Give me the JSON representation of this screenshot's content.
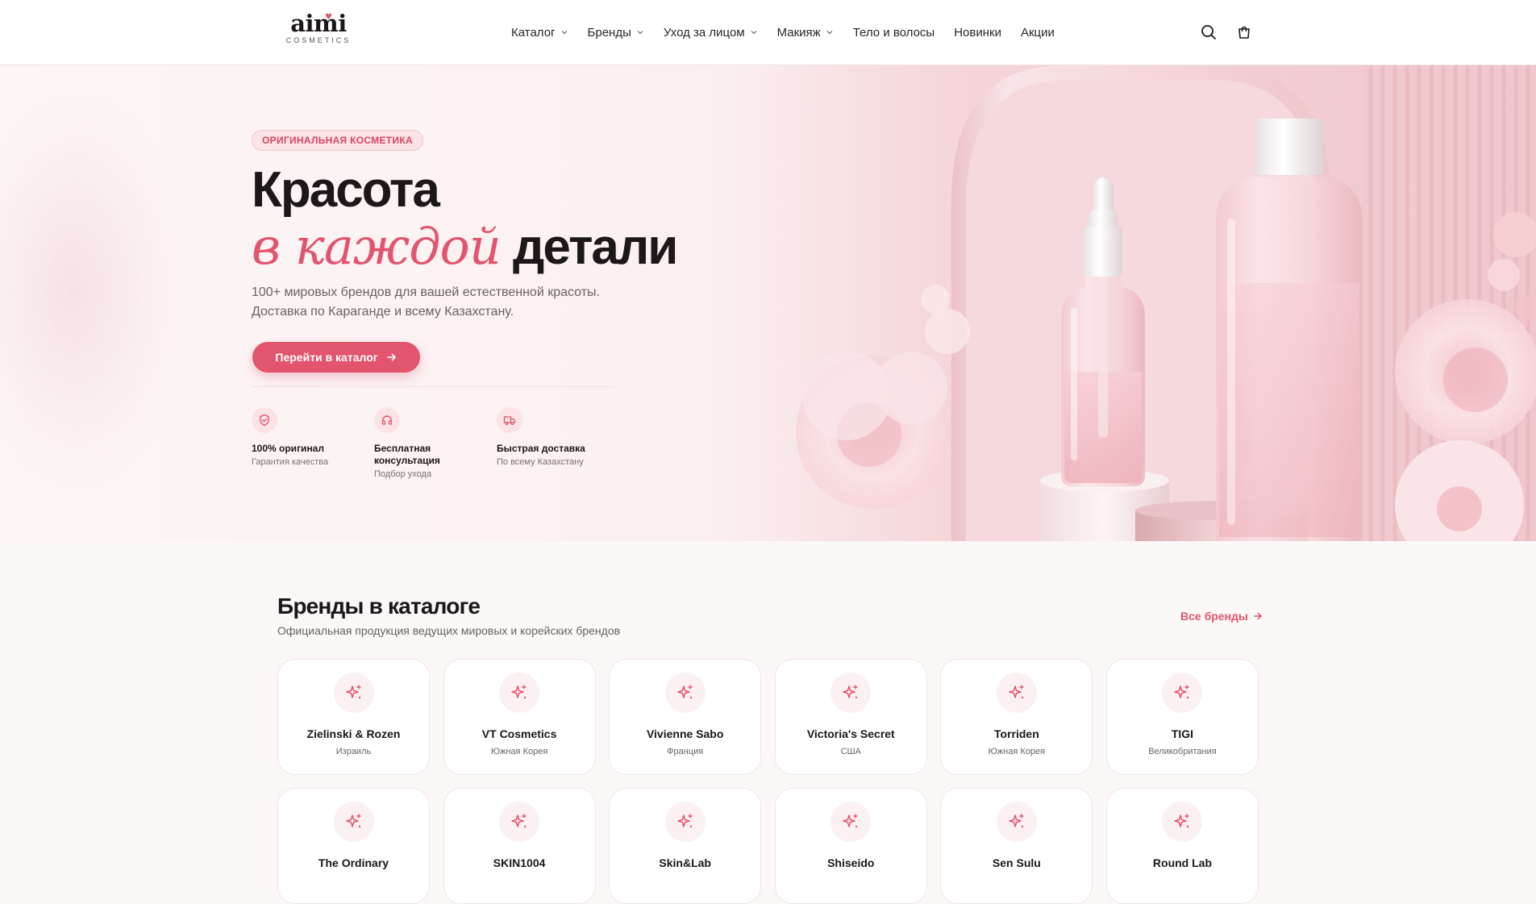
{
  "header": {
    "logo": {
      "main": "aimi",
      "sub": "COSMETICS"
    },
    "nav": [
      {
        "label": "Каталог",
        "dropdown": true
      },
      {
        "label": "Бренды",
        "dropdown": true
      },
      {
        "label": "Уход за лицом",
        "dropdown": true
      },
      {
        "label": "Макияж",
        "dropdown": true
      },
      {
        "label": "Тело и волосы",
        "dropdown": false
      },
      {
        "label": "Новинки",
        "dropdown": false
      },
      {
        "label": "Акции",
        "dropdown": false
      }
    ],
    "icons": [
      "search-icon",
      "cart-icon"
    ]
  },
  "hero": {
    "badge": "ОРИГИНАЛЬНАЯ КОСМЕТИКА",
    "title_line1": "Красота",
    "title_accent": "в каждой",
    "title_rest": "детали",
    "subtitle_line1": "100+ мировых брендов для вашей естественной красоты.",
    "subtitle_line2": "Доставка по Караганде и всему Казахстану.",
    "cta_label": "Перейти в каталог",
    "features": [
      {
        "icon": "shield-icon",
        "title": "100% оригинал",
        "desc": "Гарантия качества"
      },
      {
        "icon": "headset-icon",
        "title": "Бесплатная консультация",
        "desc": "Подбор ухода"
      },
      {
        "icon": "truck-icon",
        "title": "Быстрая доставка",
        "desc": "По всему Казахстану"
      }
    ]
  },
  "brands": {
    "title": "Бренды в каталоге",
    "subtitle": "Официальная продукция ведущих мировых и корейских брендов",
    "all_link": "Все бренды",
    "items": [
      {
        "name": "Zielinski & Rozen",
        "country": "Израиль"
      },
      {
        "name": "VT Cosmetics",
        "country": "Южная Корея"
      },
      {
        "name": "Vivienne Sabo",
        "country": "Франция"
      },
      {
        "name": "Victoria's Secret",
        "country": "США"
      },
      {
        "name": "Torriden",
        "country": "Южная Корея"
      },
      {
        "name": "TIGI",
        "country": "Великобритания"
      },
      {
        "name": "The Ordinary",
        "country": ""
      },
      {
        "name": "SKIN1004",
        "country": ""
      },
      {
        "name": "Skin&Lab",
        "country": ""
      },
      {
        "name": "Shiseido",
        "country": ""
      },
      {
        "name": "Sen Sulu",
        "country": ""
      },
      {
        "name": "Round Lab",
        "country": ""
      }
    ]
  },
  "colors": {
    "accent": "#e3546e",
    "accent_soft": "#fbe3e6",
    "text": "#1c1718",
    "muted": "#6a6163"
  }
}
